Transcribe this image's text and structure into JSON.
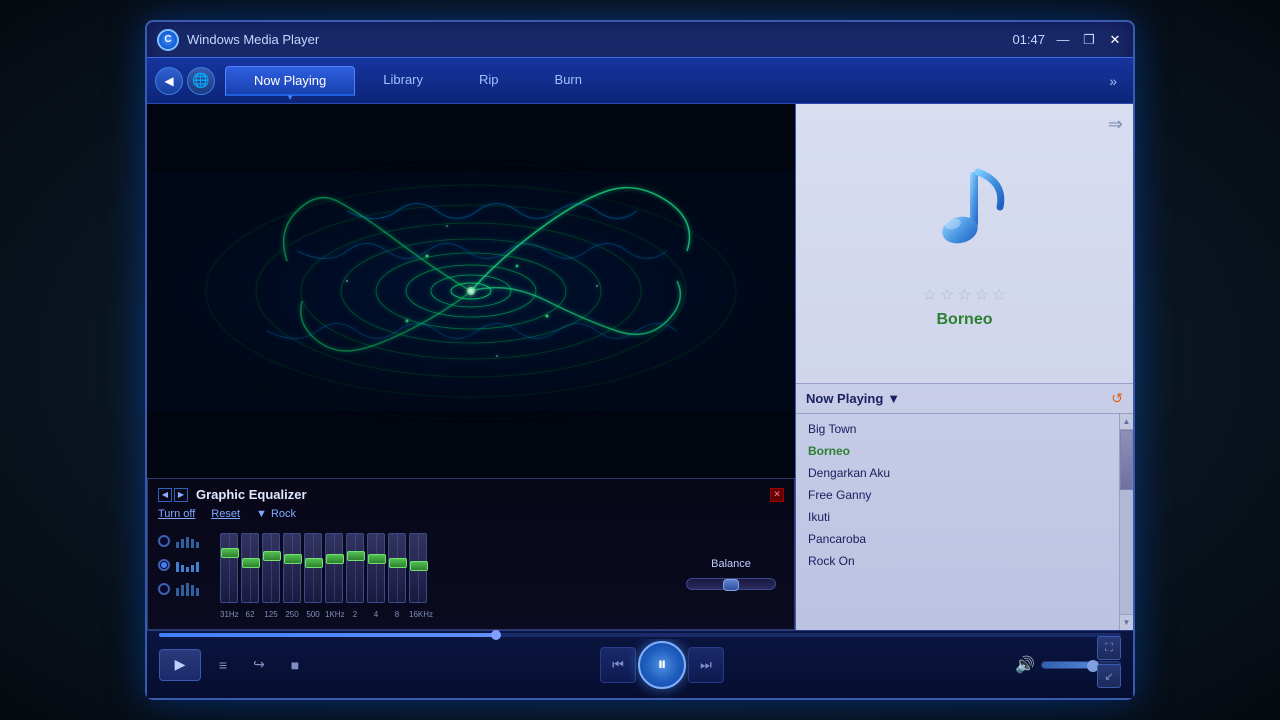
{
  "window": {
    "title": "Windows Media Player",
    "time": "01:47",
    "logo": "C"
  },
  "titlebar": {
    "minimize": "—",
    "restore": "❐",
    "close": "✕"
  },
  "navbar": {
    "back_btn": "◀",
    "globe_btn": "🌐",
    "tabs": [
      {
        "id": "now-playing",
        "label": "Now Playing",
        "active": true
      },
      {
        "id": "library",
        "label": "Library",
        "active": false
      },
      {
        "id": "rip",
        "label": "Rip",
        "active": false
      },
      {
        "id": "burn",
        "label": "Burn",
        "active": false
      }
    ],
    "more": "»"
  },
  "equalizer": {
    "title": "Graphic Equalizer",
    "turn_off": "Turn off",
    "reset": "Reset",
    "preset_arrow": "▼",
    "preset": "Rock",
    "close": "✕",
    "balance_label": "Balance",
    "freq_labels": [
      "31Hz",
      "62",
      "125",
      "250",
      "500",
      "1KHz",
      "2",
      "4",
      "8",
      "16KHz"
    ],
    "slider_positions": [
      20,
      35,
      25,
      30,
      35,
      30,
      25,
      30,
      35,
      40
    ]
  },
  "album": {
    "title": "Borneo",
    "stars": [
      "☆",
      "☆",
      "☆",
      "☆",
      "☆"
    ],
    "nav_arrow": "⇒"
  },
  "playlist": {
    "header": "Now Playing",
    "dropdown_arrow": "▼",
    "icon": "↺",
    "items": [
      {
        "id": 1,
        "title": "Big Town",
        "active": false
      },
      {
        "id": 2,
        "title": "Borneo",
        "active": true
      },
      {
        "id": 3,
        "title": "Dengarkan Aku",
        "active": false
      },
      {
        "id": 4,
        "title": "Free Ganny",
        "active": false
      },
      {
        "id": 5,
        "title": "Ikuti",
        "active": false
      },
      {
        "id": 6,
        "title": "Pancaroba",
        "active": false
      },
      {
        "id": 7,
        "title": "Rock On",
        "active": false
      }
    ]
  },
  "controls": {
    "video_btn": "▶",
    "playlist_btn": "≡",
    "minimize_btn": "↪",
    "stop_btn": "■",
    "prev_btn": "⏮",
    "pause_btn": "⏸",
    "next_btn": "⏭",
    "volume_icon": "🔊",
    "fullscreen_btn": "⛶",
    "compact_btn": "↙"
  }
}
